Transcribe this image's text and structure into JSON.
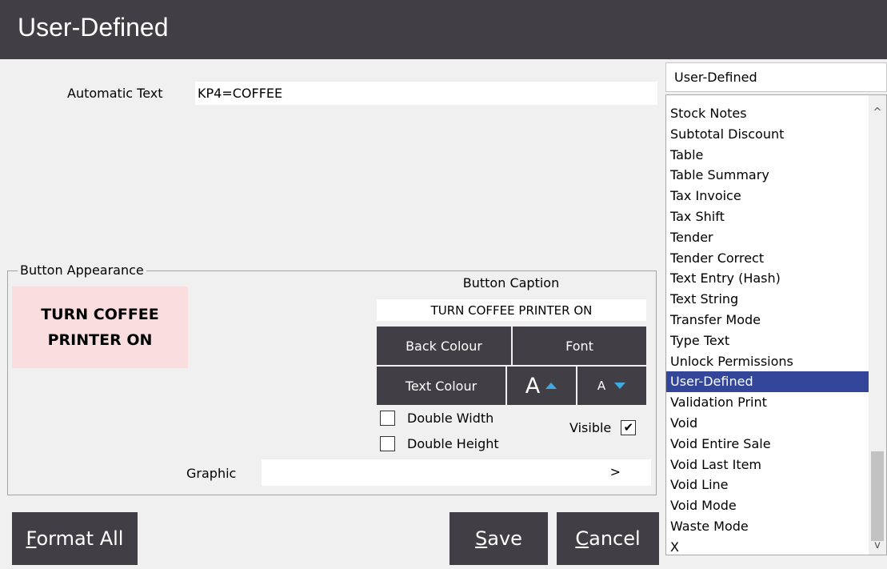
{
  "window": {
    "title": "User-Defined"
  },
  "automatic_text": {
    "label": "Automatic Text",
    "value": "KP4=COFFEE"
  },
  "button_appearance": {
    "legend": "Button Appearance",
    "preview": {
      "line1": "TURN COFFEE",
      "line2": "PRINTER ON",
      "back_colour": "#fadddf"
    },
    "caption_label": "Button Caption",
    "caption_value": "TURN COFFEE PRINTER ON",
    "back_colour_label": "Back Colour",
    "font_label": "Font",
    "text_colour_label": "Text Colour",
    "font_increase_glyph": "A",
    "font_decrease_glyph": "A",
    "double_width": {
      "label": "Double Width",
      "checked": false
    },
    "double_height": {
      "label": "Double Height",
      "checked": false
    },
    "visible": {
      "label": "Visible",
      "checked": true,
      "mark": "✔"
    },
    "graphic_label": "Graphic",
    "graphic_value": "",
    "graphic_browse": ">"
  },
  "function_select": {
    "selected": "User-Defined"
  },
  "function_list": {
    "items": [
      "Stock Notes",
      "Subtotal Discount",
      "Table",
      "Table Summary",
      "Tax Invoice",
      "Tax Shift",
      "Tender",
      "Tender Correct",
      "Text Entry (Hash)",
      "Text String",
      "Transfer Mode",
      "Type Text",
      "Unlock Permissions",
      "User-Defined",
      "Validation Print",
      "Void",
      "Void Entire Sale",
      "Void Last Item",
      "Void Line",
      "Void Mode",
      "Waste Mode",
      "X"
    ],
    "selected_index": 13
  },
  "footer": {
    "format_all": {
      "key": "F",
      "rest": "ormat All"
    },
    "save": {
      "key": "S",
      "rest": "ave"
    },
    "cancel": {
      "key": "C",
      "rest": "ancel"
    }
  },
  "colors": {
    "titlebar": "#413e46",
    "button": "#413e46",
    "selection": "#33469a",
    "accent_arrow": "#3fa9e0"
  }
}
